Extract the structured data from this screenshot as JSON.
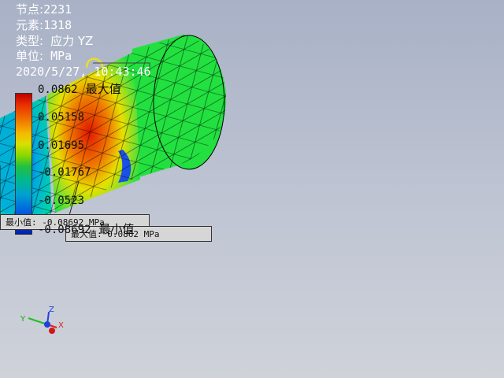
{
  "info": {
    "nodes_label": "节点:",
    "nodes_value": "2231",
    "elements_label": "元素:",
    "elements_value": "1318",
    "type_label": "类型:",
    "type_value": "应力 YZ",
    "unit_label": "单位:",
    "unit_value": "MPa",
    "timestamp": "2020/5/27, 10:43:46"
  },
  "legend": {
    "max_value": "0.0862",
    "max_tag": "最大值",
    "v2": "0.05158",
    "v3": "0.01695",
    "v4": "-0.01767",
    "v5": "-0.0523",
    "min_value": "-0.08692",
    "min_tag": "最小值"
  },
  "probes": {
    "min_probe": "最小值: -0.08692 MPa",
    "max_probe": "最大值: 0.0862 MPa"
  },
  "triad": {
    "x": "X",
    "y": "Y",
    "z": "Z"
  },
  "colors": {
    "mesh_green": "#22e040",
    "hot_red": "#e02000",
    "orange": "#f07a00",
    "yellow": "#e8e000",
    "cyan": "#00d0c8",
    "blue": "#1040e0"
  }
}
